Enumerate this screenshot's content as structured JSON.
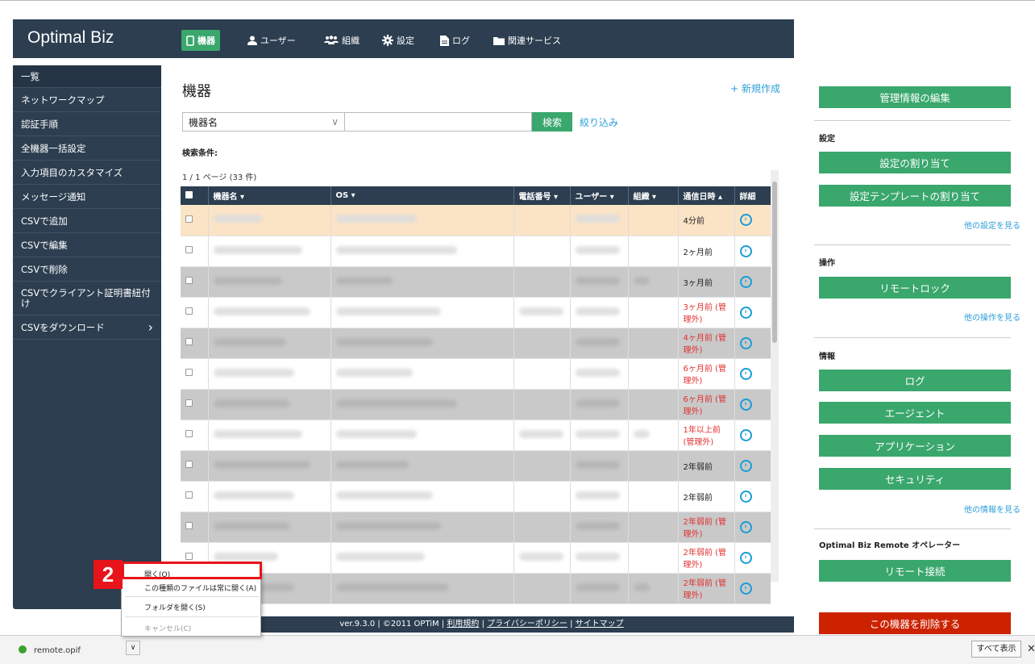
{
  "app": {
    "logo": "Optimal Biz"
  },
  "nav": [
    {
      "label": "機器",
      "icon": "device-icon"
    },
    {
      "label": "ユーザー",
      "icon": "user-icon"
    },
    {
      "label": "組織",
      "icon": "group-icon"
    },
    {
      "label": "設定",
      "icon": "gear-icon"
    },
    {
      "label": "ログ",
      "icon": "document-icon"
    },
    {
      "label": "関連サービス",
      "icon": "folder-icon"
    }
  ],
  "sidebar": {
    "items": [
      {
        "label": "一覧"
      },
      {
        "label": "ネットワークマップ"
      },
      {
        "label": "認証手順"
      },
      {
        "label": "全機器一括設定"
      },
      {
        "label": "入力項目のカスタマイズ"
      },
      {
        "label": "メッセージ通知"
      },
      {
        "label": "CSVで追加"
      },
      {
        "label": "CSVで編集"
      },
      {
        "label": "CSVで削除"
      },
      {
        "label": "CSVでクライアント証明書紐付け"
      },
      {
        "label": "CSVをダウンロード",
        "chevron": "›"
      }
    ]
  },
  "main": {
    "title": "機器",
    "new_link": "+ 新規作成",
    "search_select": "機器名",
    "search_button": "検索",
    "filter_link": "絞り込み",
    "cond_label": "検索条件:",
    "page_info": "1 / 1 ページ (33 件)"
  },
  "table": {
    "headers": [
      "機器名 ▾",
      "OS ▾",
      "電話番号 ▾",
      "ユーザー ▾",
      "組織 ▾",
      "通信日時 ▴",
      "詳細"
    ],
    "rows": [
      {
        "time": "4分前",
        "red": false
      },
      {
        "time": "2ヶ月前",
        "red": false
      },
      {
        "time": "3ヶ月前",
        "red": false
      },
      {
        "time": "3ヶ月前 (管理外)",
        "red": true
      },
      {
        "time": "4ヶ月前 (管理外)",
        "red": true
      },
      {
        "time": "6ヶ月前 (管理外)",
        "red": true
      },
      {
        "time": "6ヶ月前 (管理外)",
        "red": true
      },
      {
        "time": "1年以上前 (管理外)",
        "red": true
      },
      {
        "time": "2年弱前",
        "red": false
      },
      {
        "time": "2年弱前",
        "red": false
      },
      {
        "time": "2年弱前 (管理外)",
        "red": true
      },
      {
        "time": "2年弱前 (管理外)",
        "red": true
      },
      {
        "time": "2年弱前 (管理外)",
        "red": true
      }
    ]
  },
  "footer": {
    "version": "ver.9.3.0 | ©2011 OPTiM | ",
    "terms": "利用規約",
    "privacy": "プライバシーポリシー",
    "sitemap": "サイトマップ"
  },
  "right_panel": {
    "edit_button": "管理情報の編集",
    "settings_heading": "設定",
    "assign_settings": "設定の割り当て",
    "assign_template": "設定テンプレートの割り当て",
    "more_settings": "他の設定を見る",
    "operations_heading": "操作",
    "remote_lock": "リモートロック",
    "more_operations": "他の操作を見る",
    "info_heading": "情報",
    "log": "ログ",
    "agent": "エージェント",
    "application": "アプリケーション",
    "security": "セキュリティ",
    "more_info": "他の情報を見る",
    "remote_heading": "Optimal Biz Remote オペレーター",
    "remote_connect": "リモート接続",
    "delete_device": "この機器を削除する"
  },
  "download_bar": {
    "file_name": "remote.opif",
    "show_all": "すべて表示",
    "close": "✕"
  },
  "context_menu": {
    "open": "開く(O)",
    "always_open": "この種類のファイルは常に開く(A)",
    "open_folder": "フォルダを開く(S)",
    "cancel": "キャンセル(C)"
  },
  "step_badge": "2",
  "colors": {
    "nav_dark": "#2c3e50",
    "accent_green": "#3aa76d",
    "delete_red": "#cc2200",
    "link_blue": "#2b9fd8",
    "highlight_red": "#e8141b"
  }
}
